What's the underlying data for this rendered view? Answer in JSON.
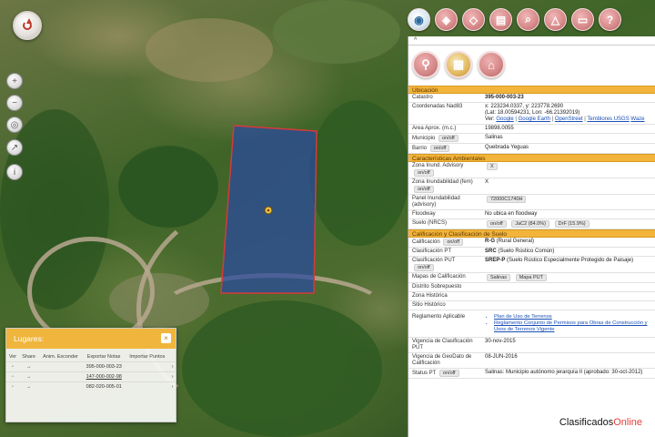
{
  "toolbar": {
    "buttons": [
      {
        "icon": "globe-icon"
      },
      {
        "icon": "layers-icon"
      },
      {
        "icon": "layers-alt-icon"
      },
      {
        "icon": "document-icon"
      },
      {
        "icon": "search-icon"
      },
      {
        "icon": "measure-icon"
      },
      {
        "icon": "print-icon"
      },
      {
        "icon": "help-icon"
      }
    ]
  },
  "left_tools": [
    "zoom-in-icon",
    "zoom-out-icon",
    "location-icon",
    "share-icon",
    "info-icon"
  ],
  "panel": {
    "gripper": "^",
    "sections": {
      "ubicacion": "Ubicación",
      "ambientales": "Características Ambientales",
      "calificacion": "Calificación y Clasificación de Suelo"
    },
    "rows": {
      "catastro": {
        "label": "Catastro",
        "value": "395-000-003-23"
      },
      "coords": {
        "label": "Coordenadas Nad83",
        "line1": "x: 223234.0337, y: 223778.2690",
        "line2": "(Lat: 18.00594231, Lon: -66.21392019)",
        "ver": "Ver:",
        "links": [
          "Google",
          "Google Earth",
          "OpenStreet",
          "Temblores USGS",
          "Waze"
        ]
      },
      "area": {
        "label": "Area Aprox. (m.c.)",
        "value": "19898.0055"
      },
      "municipio": {
        "label": "Municipio",
        "pill": "on/off",
        "value": "Salinas"
      },
      "barrio": {
        "label": "Barrio",
        "pill": "on/off",
        "value": "Quebrada Yeguas"
      },
      "zona_inund": {
        "label": "Zona Inund. Advisory",
        "pill": "on/off",
        "value": "X"
      },
      "zona_fem": {
        "label": "Zona Inundabilidad (fem)",
        "pill": "on/off",
        "value": "X"
      },
      "panel_inund": {
        "label": "Panel Inundabilidad (advisory)",
        "pill": "72000C1740H"
      },
      "floodway": {
        "label": "Floodway",
        "value": "No ubica en floodway"
      },
      "suelo": {
        "label": "Suelo (NRCS)",
        "pill": "on/off",
        "v1": "JaC2 (84.0%)",
        "v2": "DrF (15.9%)"
      },
      "calif": {
        "label": "Calificación",
        "pill": "on/off",
        "bold": "R-G",
        "value": "(Rural General)"
      },
      "clas_pt": {
        "label": "Clasificación PT",
        "bold": "SRC",
        "value": "(Suelo Rústico Común)"
      },
      "clas_put": {
        "label": "Clasificación PUT",
        "pill": "on/off",
        "bold": "SREP-P",
        "value": "(Suelo Rústico Especialmente Protegido de Paisaje)"
      },
      "mapas": {
        "label": "Mapas de Calificación",
        "p1": "Salinas",
        "p2": "Mapa PUT"
      },
      "distrito": {
        "label": "Distrito Sobrepuesto"
      },
      "zona_hist": {
        "label": "Zona Histórica"
      },
      "sitio_hist": {
        "label": "Sitio Histórico"
      },
      "reglamento": {
        "label": "Reglamento Aplicable",
        "items": [
          "Plan de Uso de Terrenos",
          "Reglamento Conjunto de Permisos para Obras de Construcción y Usos de Terrenos Vigente"
        ]
      },
      "vig_calif": {
        "label": "Vigencia de Clasificación PUT",
        "value": "30-nov-2015"
      },
      "vig_geo": {
        "label": "Vigencia de GeoDato de Calificación",
        "value": "08-JUN-2016"
      },
      "status_pt": {
        "label": "Status PT",
        "pill": "on/off",
        "value": "Salinas: Municipio autónomo jerarquía II (aprobado: 30-oct-2012)"
      }
    }
  },
  "lugares": {
    "title": "Lugares:",
    "close": "×",
    "headers": [
      "Ver",
      "Share",
      "Anim. Esconder",
      "Exportar Notas",
      "Importar Puntos",
      ""
    ],
    "rows": [
      {
        "ver": "◦",
        "share": "→",
        "id": "395-000-003-23",
        "arrow": "›"
      },
      {
        "ver": "◦",
        "share": "→",
        "id": "147-000-002-98",
        "arrow": "›"
      },
      {
        "ver": "◦",
        "share": "→",
        "id": "082-020-005-01",
        "arrow": "›"
      }
    ]
  },
  "watermark": {
    "text": "Clasificados",
    "accent": "Online"
  },
  "colors": {
    "accent": "#f2b43a",
    "parcel_stroke": "#d63a3a",
    "parcel_fill": "#2a4aa0",
    "button": "#d98c8c"
  }
}
